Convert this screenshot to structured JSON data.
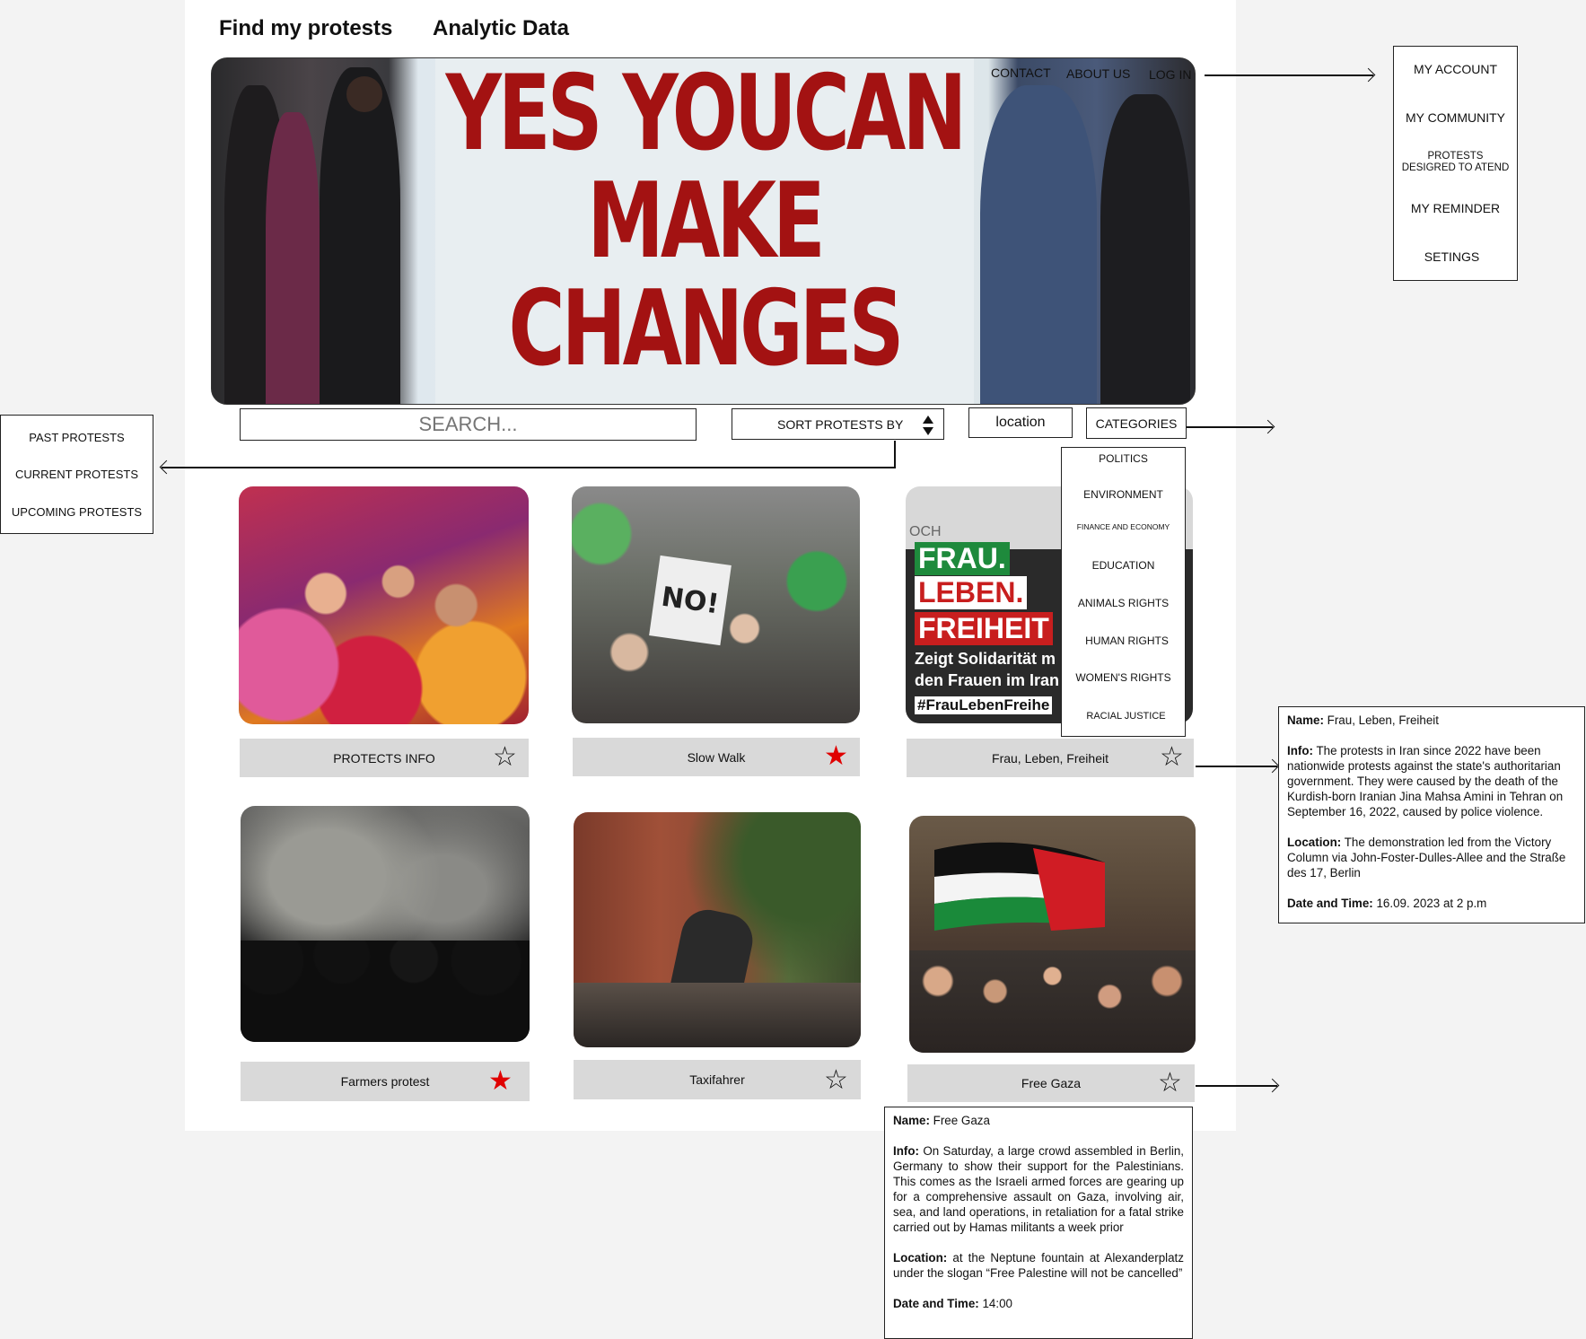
{
  "header": {
    "title": "Find my protests",
    "nav_analytic": "Analytic",
    "nav_data": "Data"
  },
  "hero": {
    "links": {
      "contact": "CONTACT",
      "about": "ABOUT US",
      "login": "LOG IN"
    },
    "sign_lines": [
      "YES YOUCAN",
      "MAKE",
      "CHANGES"
    ],
    "sign_color": "#a31212"
  },
  "account_menu": {
    "items": [
      "MY ACCOUNT",
      "MY COMMUNITY",
      "PROTESTS DESIGRED TO ATEND",
      "MY REMINDER",
      "SETINGS"
    ]
  },
  "search": {
    "placeholder": "SEARCH..."
  },
  "sort": {
    "label": "SORT PROTESTS BY",
    "options": [
      "PAST PROTESTS",
      "CURRENT PROTESTS",
      "UPCOMING PROTESTS"
    ]
  },
  "location": {
    "label": "location"
  },
  "categories": {
    "label": "CATEGORIES",
    "items": [
      "POLITICS",
      "ENVIRONMENT",
      "FINANCE AND ECONOMY",
      "EDUCATION",
      "ANIMALS RIGHTS",
      "HUMAN RIGHTS",
      "WOMEN'S RIGHTS",
      "RACIAL JUSTICE"
    ]
  },
  "cards": [
    {
      "title": "PROTECTS INFO",
      "starred": false
    },
    {
      "title": "Slow Walk",
      "starred": true
    },
    {
      "title": "Frau, Leben, Freiheit",
      "starred": false
    },
    {
      "title": "Farmers protest",
      "starred": true
    },
    {
      "title": "Taxifahrer",
      "starred": false
    },
    {
      "title": "Free Gaza",
      "starred": false
    }
  ],
  "poster": {
    "lines": [
      "FRAU.",
      "LEBEN.",
      "FREIHEIT"
    ],
    "sub1": "Zeigt Solidarität m",
    "sub2": "den Frauen im Iran",
    "tag": "#FrauLebenFreihe",
    "corner": "OCH"
  },
  "no_sign": "NO!",
  "info_frau": {
    "name_label": "Name:",
    "name": "Frau, Leben, Freiheit",
    "info_label": "Info:",
    "info": "The protests in Iran since 2022 have been nationwide protests against the state's authoritarian government. They were caused by the death of the Kurdish-born Iranian Jina Mahsa Amini in Tehran on September 16, 2022, caused by police violence.",
    "location_label": "Location:",
    "location": "The demonstration led from the Victory Column via John-Foster-Dulles-Allee and the Straße des 17, Berlin",
    "date_label": "Date and Time:",
    "date": "16.09. 2023 at 2 p.m"
  },
  "info_gaza": {
    "name_label": "Name:",
    "name": "Free Gaza",
    "info_label": "Info:",
    "info": "On Saturday, a large crowd assembled in Berlin, Germany to show their support for the Palestinians. This comes as the Israeli armed forces are gearing up for a comprehensive assault on Gaza, involving air, sea, and land operations, in retaliation for a fatal strike carried out by Hamas militants a week prior",
    "location_label": "Location:",
    "location": "at the Neptune fountain at Alexanderplatz under the slogan “Free Palestine will not be cancelled”",
    "date_label": "Date and Time:",
    "date": "14:00"
  },
  "colors": {
    "star_active": "#e00000",
    "bar_gray": "#d9d9d9",
    "page_bg": "#f3f3f3"
  }
}
